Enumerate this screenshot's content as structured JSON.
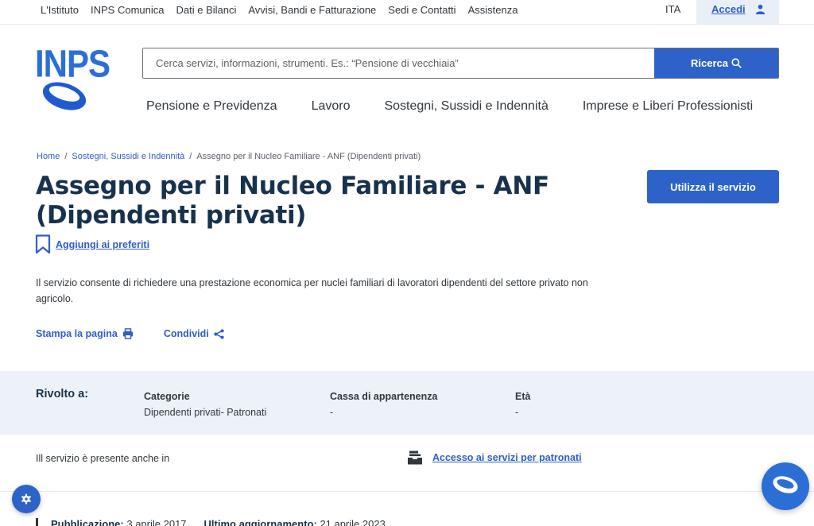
{
  "topbar": {
    "links": [
      "L'Istituto",
      "INPS Comunica",
      "Dati e Bilanci",
      "Avvisi, Bandi e Fatturazione",
      "Sedi e Contatti",
      "Assistenza"
    ],
    "language": "ITA",
    "login_label": "Accedi"
  },
  "header": {
    "logo_text": "INPS",
    "search_placeholder": "Cerca servizi, informazioni, strumenti. Es.: “Pensione di vecchiaia”",
    "search_button": "Ricerca",
    "nav": [
      "Pensione e Previdenza",
      "Lavoro",
      "Sostegni, Sussidi e Indennità",
      "Imprese e Liberi Professionisti"
    ]
  },
  "breadcrumb": {
    "home": "Home",
    "section": "Sostegni, Sussidi e Indennità",
    "current": "Assegno per il Nucleo Familiare - ANF (Dipendenti privati)",
    "separator": "/"
  },
  "page": {
    "title": "Assegno per il Nucleo Familiare - ANF (Dipendenti privati)",
    "use_service_button": "Utilizza il servizio",
    "favorite_label": "Aggiungi ai preferiti",
    "description": "Il servizio consente di richiedere una prestazione economica per nuclei familiari di lavoratori dipendenti del settore privato non agricolo.",
    "print_label": "Stampa la pagina",
    "share_label": "Condividi"
  },
  "audience": {
    "heading": "Rivolto a:",
    "columns": [
      {
        "key": "Categorie",
        "value": "Dipendenti privati- Patronati"
      },
      {
        "key": "Cassa di appartenenza",
        "value": "-"
      },
      {
        "key": "Età",
        "value": "-"
      }
    ]
  },
  "also_in": {
    "label": "Ill servizio è presente anche in",
    "link": "Accesso ai servizi per patronati"
  },
  "publication": {
    "pub_label": "Pubblicazione:",
    "pub_date": "3 aprile 2017",
    "upd_label": "Ultimo aggiornamento:",
    "upd_date": "21 aprile 2023"
  },
  "colors": {
    "primary": "#2d63c8",
    "title": "#17324d",
    "band": "#edf2f8"
  }
}
